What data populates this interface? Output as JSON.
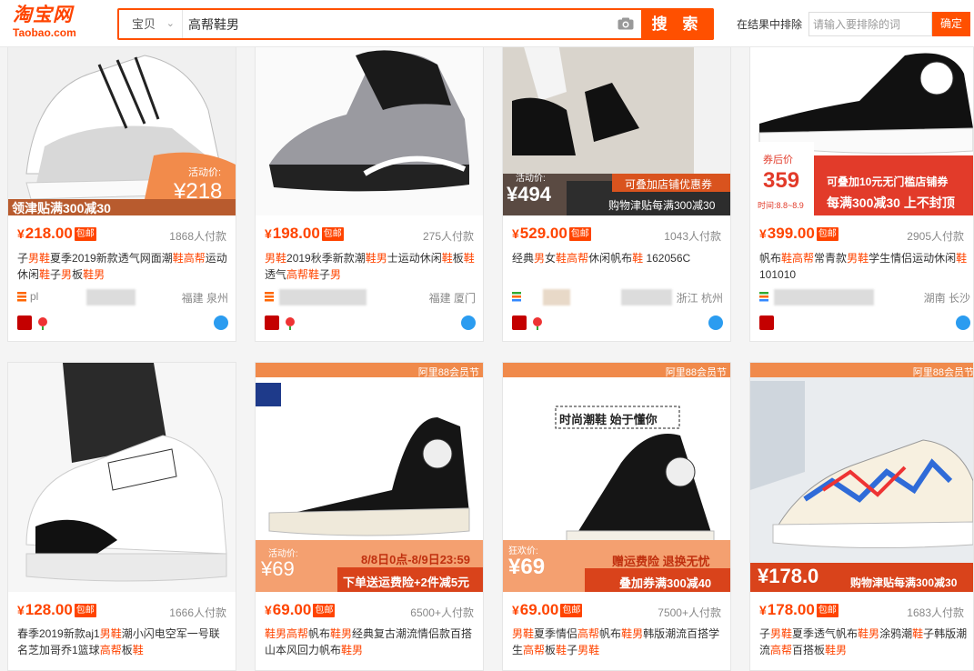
{
  "header": {
    "logo_cn": "淘宝网",
    "logo_en": "Taobao.com",
    "search_type": "宝贝",
    "search_query": "高帮鞋男",
    "search_button": "搜 索",
    "exclude_label": "在结果中排除",
    "exclude_placeholder": "请输入要排除的词",
    "exclude_button": "确定"
  },
  "colors": {
    "accent": "#ff4400",
    "search_orange": "#ff5000"
  },
  "baoyou": "包邮",
  "products": [
    {
      "price": "218.00",
      "paid": "1868人付款",
      "title_parts": [
        [
          "子",
          0
        ],
        [
          "男鞋",
          1
        ],
        [
          "夏季2019新款透气网面潮",
          0
        ],
        [
          "鞋",
          1
        ],
        [
          "高帮",
          1
        ],
        [
          "运动休闲",
          0
        ],
        [
          "鞋",
          1
        ],
        [
          "子",
          0
        ],
        [
          "男",
          1
        ],
        [
          "板",
          0
        ],
        [
          "鞋男",
          1
        ]
      ],
      "shop_name": "pl",
      "location": "福建 泉州",
      "badge_tmall": true,
      "badge_flower": true,
      "promo_top": "活动价:",
      "promo_price": "¥218",
      "promo_banner": "领津贴满300减30"
    },
    {
      "price": "198.00",
      "paid": "275人付款",
      "title_parts": [
        [
          "男鞋",
          1
        ],
        [
          "2019秋季新款潮",
          0
        ],
        [
          "鞋男",
          1
        ],
        [
          "士运动",
          0
        ],
        [
          "休闲",
          0
        ],
        [
          "鞋",
          1
        ],
        [
          "板",
          0
        ],
        [
          "鞋",
          1
        ],
        [
          "透气",
          0
        ],
        [
          "高帮鞋",
          1
        ],
        [
          "子",
          0
        ],
        [
          "男",
          1
        ]
      ],
      "shop_name": "",
      "location": "福建 厦门",
      "badge_tmall": true,
      "badge_flower": true
    },
    {
      "price": "529.00",
      "paid": "1043人付款",
      "title_parts": [
        [
          "经典",
          0
        ],
        [
          "男",
          1
        ],
        [
          "女",
          0
        ],
        [
          "鞋高",
          1
        ],
        [
          "帮",
          1
        ],
        [
          "休闲帆布",
          0
        ],
        [
          "鞋",
          1
        ],
        [
          " 162056C",
          0
        ]
      ],
      "shop_name": "",
      "location": "浙江 杭州",
      "badge_tmall": true,
      "badge_flower": true,
      "promo_top": "活动价:",
      "promo_price": "¥494",
      "promo_banner": "购物津贴每满300减30",
      "promo_tag": "可叠加店铺优惠券"
    },
    {
      "price": "399.00",
      "paid": "2905人付款",
      "title_parts": [
        [
          "帆布",
          0
        ],
        [
          "鞋",
          1
        ],
        [
          "高帮",
          1
        ],
        [
          "常青款",
          0
        ],
        [
          "男鞋",
          1
        ],
        [
          "学生情侣运动休闲",
          0
        ],
        [
          "鞋",
          1
        ],
        [
          "101010",
          0
        ]
      ],
      "shop_name": "",
      "location": "湖南 长沙",
      "badge_tmall": true,
      "badge_flower": false,
      "promo_top": "券后价",
      "promo_price": "359",
      "promo_time": "时间:8.8~8.9",
      "promo_tag": "可叠加10元无门槛店铺券",
      "promo_banner": "每满300减30 上不封顶"
    },
    {
      "price": "128.00",
      "paid": "1666人付款",
      "title_parts": [
        [
          "春季2019新款aj1",
          0
        ],
        [
          "男鞋",
          1
        ],
        [
          "潮小闪电空军一号联名芝加哥乔1篮球",
          0
        ],
        [
          "高帮",
          1
        ],
        [
          "板",
          0
        ],
        [
          "鞋",
          1
        ]
      ],
      "shop_name": "",
      "location": "",
      "badge_tmall": false,
      "badge_flower": false
    },
    {
      "price": "69.00",
      "paid": "6500+人付款",
      "title_parts": [
        [
          "鞋男高帮",
          1
        ],
        [
          "帆布",
          0
        ],
        [
          "鞋男",
          1
        ],
        [
          "经典复古潮流情侣款百搭山本风回力帆布",
          0
        ],
        [
          "鞋男",
          1
        ]
      ],
      "shop_name": "",
      "location": "",
      "badge_tmall": false,
      "badge_flower": false,
      "promo_corner": "阿里88会员节",
      "promo_top": "活动价:",
      "promo_price": "¥69",
      "promo_date": "8/8日0点-8/9日23:59",
      "promo_banner": "下单送运费险+2件减5元"
    },
    {
      "price": "69.00",
      "paid": "7500+人付款",
      "title_parts": [
        [
          "男鞋",
          1
        ],
        [
          "夏季情侣",
          0
        ],
        [
          "高帮",
          1
        ],
        [
          "帆布",
          0
        ],
        [
          "鞋男",
          1
        ],
        [
          "韩版潮流百搭学生",
          0
        ],
        [
          "高帮",
          1
        ],
        [
          "板",
          0
        ],
        [
          "鞋",
          1
        ],
        [
          "子",
          0
        ],
        [
          "男鞋",
          1
        ]
      ],
      "shop_name": "",
      "location": "",
      "badge_tmall": false,
      "badge_flower": false,
      "promo_corner": "阿里88会员节",
      "promo_slogan": "时尚潮鞋 始于懂你",
      "promo_top": "狂欢价:",
      "promo_price": "¥69",
      "promo_tag": "赠运费险 退换无忧",
      "promo_banner": "叠加券满300减40"
    },
    {
      "price": "178.00",
      "paid": "1683人付款",
      "title_parts": [
        [
          "子",
          0
        ],
        [
          "男鞋",
          1
        ],
        [
          "夏季透气帆布",
          0
        ],
        [
          "鞋男",
          1
        ],
        [
          "涂鸦潮",
          0
        ],
        [
          "鞋",
          1
        ],
        [
          "子",
          0
        ],
        [
          "韩版潮流",
          0
        ],
        [
          "高帮",
          1
        ],
        [
          "百搭板",
          0
        ],
        [
          "鞋男",
          1
        ]
      ],
      "shop_name": "",
      "location": "",
      "badge_tmall": false,
      "badge_flower": false,
      "promo_corner": "阿里88会员节",
      "promo_price": "¥178.0",
      "promo_banner": "购物津贴每满300减30"
    }
  ]
}
